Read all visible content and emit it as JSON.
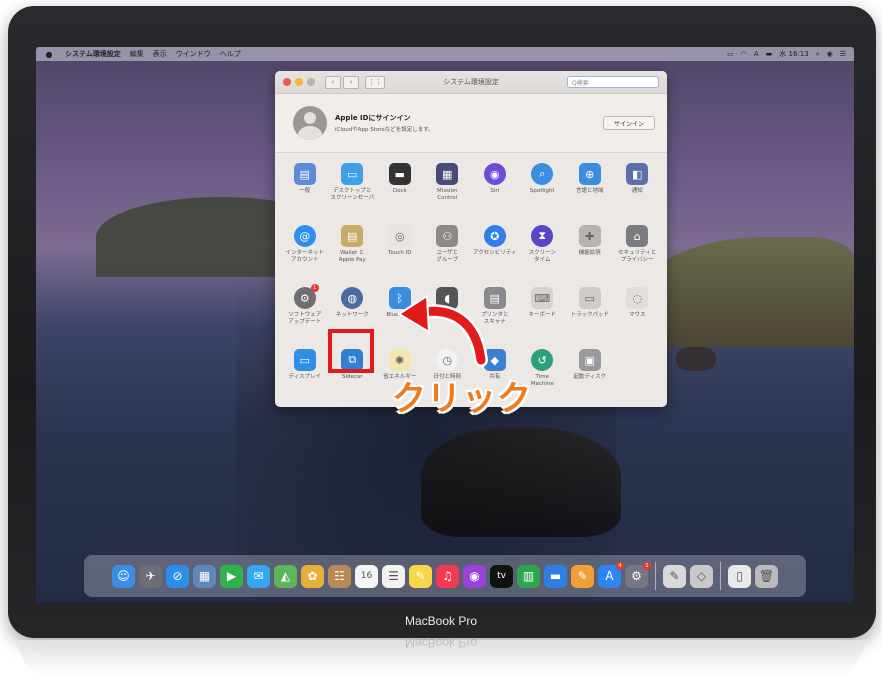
{
  "menubar": {
    "apple": "",
    "app_name": "システム環境設定",
    "items": [
      "編集",
      "表示",
      "ウインドウ",
      "ヘルプ"
    ],
    "clock": "水 16:13"
  },
  "window": {
    "title": "システム環境設定",
    "search_placeholder": "Q検索",
    "apple_id": {
      "title": "Apple IDにサインイン",
      "subtitle": "iCloudやApp Storeなどを設定します。",
      "signin_button": "サインイン"
    },
    "panes": [
      {
        "label": "一般",
        "icon": "general-icon",
        "color": "#5b8bd6",
        "glyph": "▤"
      },
      {
        "label": "デスクトップと\nスクリーンセーバ",
        "icon": "desktop-icon",
        "color": "#3fa0e6",
        "glyph": "▭"
      },
      {
        "label": "Dock",
        "icon": "dock-icon",
        "color": "#333333",
        "glyph": "▬"
      },
      {
        "label": "Mission\nControl",
        "icon": "mission-control-icon",
        "color": "#4a4a7a",
        "glyph": "▦"
      },
      {
        "label": "Siri",
        "icon": "siri-icon",
        "color": "#6f4bd6",
        "glyph": "◉"
      },
      {
        "label": "Spotlight",
        "icon": "spotlight-icon",
        "color": "#3b8de0",
        "glyph": "⌕"
      },
      {
        "label": "言語と地域",
        "icon": "language-icon",
        "color": "#3b8de0",
        "glyph": "⊕"
      },
      {
        "label": "通知",
        "icon": "notifications-icon",
        "color": "#5b6fa8",
        "glyph": "◧"
      },
      {
        "label": "インターネット\nアカウント",
        "icon": "internet-accounts-icon",
        "color": "#2d8ff0",
        "glyph": "@"
      },
      {
        "label": "Wallet と\nApple Pay",
        "icon": "wallet-icon",
        "color": "#c9a96a",
        "glyph": "▤"
      },
      {
        "label": "Touch ID",
        "icon": "touch-id-icon",
        "color": "#e9e4e4",
        "glyph": "◎"
      },
      {
        "label": "ユーザと\nグループ",
        "icon": "users-icon",
        "color": "#8d8a87",
        "glyph": "⚇"
      },
      {
        "label": "アクセシビリティ",
        "icon": "accessibility-icon",
        "color": "#2f7fe8",
        "glyph": "✪"
      },
      {
        "label": "スクリーン\nタイム",
        "icon": "screen-time-icon",
        "color": "#5a46c4",
        "glyph": "⧗"
      },
      {
        "label": "機能拡張",
        "icon": "extensions-icon",
        "color": "#b9b4b0",
        "glyph": "✚"
      },
      {
        "label": "セキュリティと\nプライバシー",
        "icon": "security-icon",
        "color": "#7b7b80",
        "glyph": "⌂"
      },
      {
        "label": "ソフトウェア\nアップデート",
        "icon": "software-update-icon",
        "color": "#6d6d72",
        "glyph": "⚙",
        "badge": "1"
      },
      {
        "label": "ネットワーク",
        "icon": "network-icon",
        "color": "#4c6aa0",
        "glyph": "◍"
      },
      {
        "label": "Bluetooth",
        "icon": "bluetooth-icon",
        "color": "#3b8de0",
        "glyph": "ᛒ"
      },
      {
        "label": "サウンド",
        "icon": "sound-icon",
        "color": "#555555",
        "glyph": "◖"
      },
      {
        "label": "プリンタと\nスキャナ",
        "icon": "printer-icon",
        "color": "#8a8a8e",
        "glyph": "▤"
      },
      {
        "label": "キーボード",
        "icon": "keyboard-icon",
        "color": "#d7d3d0",
        "glyph": "⌨"
      },
      {
        "label": "トラックパッド",
        "icon": "trackpad-icon",
        "color": "#cfcbc8",
        "glyph": "▭"
      },
      {
        "label": "マウス",
        "icon": "mouse-icon",
        "color": "#e1ddda",
        "glyph": "◌"
      },
      {
        "label": "ディスプレイ",
        "icon": "display-icon",
        "color": "#2f8fe4",
        "glyph": "▭"
      },
      {
        "label": "Sidecar",
        "icon": "sidecar-icon",
        "color": "#2f7fd4",
        "glyph": "⧉"
      },
      {
        "label": "省エネルギー",
        "icon": "energy-saver-icon",
        "color": "#f2e7b0",
        "glyph": "✺"
      },
      {
        "label": "日付と時刻",
        "icon": "date-time-icon",
        "color": "#f2f2f2",
        "glyph": "◷"
      },
      {
        "label": "共有",
        "icon": "sharing-icon",
        "color": "#3d7fd2",
        "glyph": "◆"
      },
      {
        "label": "Time\nMachine",
        "icon": "time-machine-icon",
        "color": "#2d9f7d",
        "glyph": "↺"
      },
      {
        "label": "起動ディスク",
        "icon": "startup-disk-icon",
        "color": "#9a9a9e",
        "glyph": "▣"
      },
      {
        "label": "",
        "icon": "empty",
        "color": "transparent",
        "glyph": ""
      }
    ]
  },
  "annotation": {
    "text": "クリック",
    "color": "#f07b1d",
    "highlight_color": "#e21a1a"
  },
  "dock": [
    {
      "name": "finder-dock-icon",
      "color": "#3a8ee6",
      "glyph": "☺"
    },
    {
      "name": "launchpad-dock-icon",
      "color": "#6d6d75",
      "glyph": "✈"
    },
    {
      "name": "safari-dock-icon",
      "color": "#2c8ee8",
      "glyph": "⊘"
    },
    {
      "name": "preview-dock-icon",
      "color": "#5e88b5",
      "glyph": "▦"
    },
    {
      "name": "facetime-dock-icon",
      "color": "#2fb34a",
      "glyph": "▶"
    },
    {
      "name": "messages-dock-icon",
      "color": "#35a7f0",
      "glyph": "✉"
    },
    {
      "name": "maps-dock-icon",
      "color": "#5fb65a",
      "glyph": "◭"
    },
    {
      "name": "photos-dock-icon",
      "color": "#e7b03a",
      "glyph": "✿"
    },
    {
      "name": "contacts-dock-icon",
      "color": "#b88a55",
      "glyph": "☷"
    },
    {
      "name": "calendar-dock-icon",
      "color": "#f5f5f5",
      "glyph": "16"
    },
    {
      "name": "reminders-dock-icon",
      "color": "#f2f2f2",
      "glyph": "☰"
    },
    {
      "name": "notes-dock-icon",
      "color": "#f7d64a",
      "glyph": "✎"
    },
    {
      "name": "music-dock-icon",
      "color": "#f23a55",
      "glyph": "♫"
    },
    {
      "name": "podcasts-dock-icon",
      "color": "#9b42d8",
      "glyph": "◉"
    },
    {
      "name": "tv-dock-icon",
      "color": "#111111",
      "glyph": "tv"
    },
    {
      "name": "numbers-dock-icon",
      "color": "#2ea64c",
      "glyph": "▥"
    },
    {
      "name": "keynote-dock-icon",
      "color": "#2f7fe2",
      "glyph": "▬"
    },
    {
      "name": "pages-dock-icon",
      "color": "#f0a035",
      "glyph": "✎"
    },
    {
      "name": "app-store-dock-icon",
      "color": "#2d86ef",
      "glyph": "A",
      "badge": "4"
    },
    {
      "name": "system-preferences-dock-icon",
      "color": "#777780",
      "glyph": "⚙",
      "badge": "1"
    },
    {
      "name": "separator"
    },
    {
      "name": "textedit-dock-icon",
      "color": "#d9d9d9",
      "glyph": "✎"
    },
    {
      "name": "preview-file-dock-icon",
      "color": "#c9c9c9",
      "glyph": "◇"
    },
    {
      "name": "separator"
    },
    {
      "name": "documents-dock-icon",
      "color": "#e9e9e9",
      "glyph": "▯"
    },
    {
      "name": "trash-dock-icon",
      "color": "#bbbbbb",
      "glyph": "🗑"
    }
  ],
  "brand": "MacBook Pro"
}
